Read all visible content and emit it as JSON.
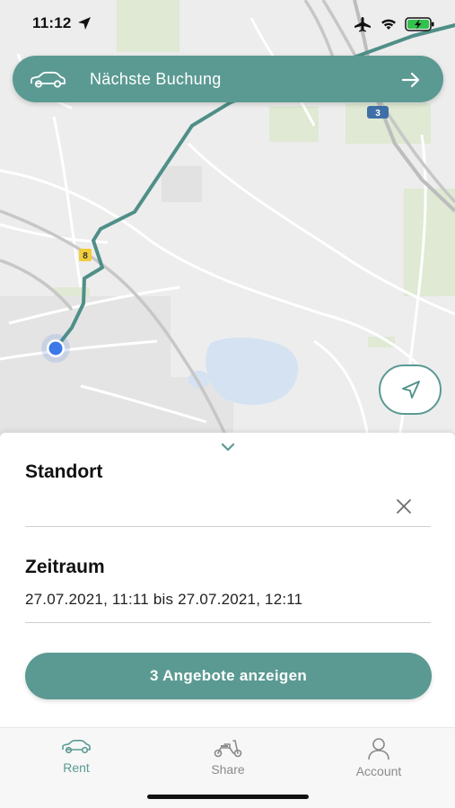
{
  "status_bar": {
    "time": "11:12"
  },
  "map": {
    "route_color": "#4f8f88",
    "road_labels": [
      "3",
      "8"
    ]
  },
  "booking": {
    "label": "Nächste Buchung"
  },
  "sheet": {
    "location_title": "Standort",
    "location_value": "",
    "period_title": "Zeitraum",
    "period_value": "27.07.2021, 11:11 bis 27.07.2021, 12:11",
    "offers_button": "3 Angebote anzeigen"
  },
  "tabs": [
    {
      "label": "Rent",
      "icon": "car-icon",
      "active": true
    },
    {
      "label": "Share",
      "icon": "scooter-icon",
      "active": false
    },
    {
      "label": "Account",
      "icon": "person-icon",
      "active": false
    }
  ],
  "colors": {
    "accent": "#5a9a92",
    "map_background": "#ededed"
  }
}
